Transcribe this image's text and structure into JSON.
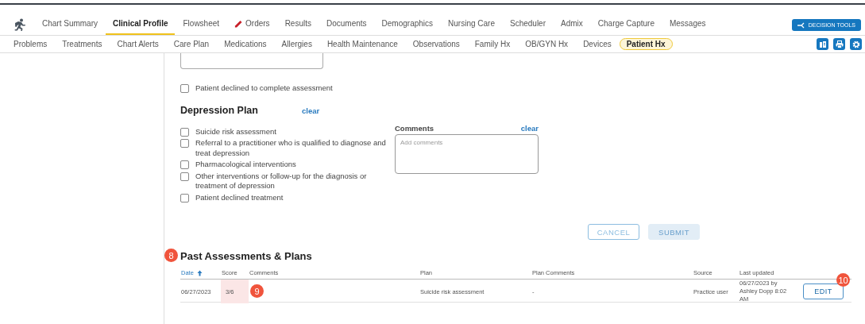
{
  "main_nav": [
    {
      "label": "Chart Summary",
      "selected": false,
      "kind": "text"
    },
    {
      "label": "Clinical Profile",
      "selected": true,
      "kind": "text"
    },
    {
      "label": "Flowsheet",
      "selected": false,
      "kind": "text"
    },
    {
      "label": "Orders",
      "selected": false,
      "kind": "pencil"
    },
    {
      "label": "Results",
      "selected": false,
      "kind": "text"
    },
    {
      "label": "Documents",
      "selected": false,
      "kind": "text"
    },
    {
      "label": "Demographics",
      "selected": false,
      "kind": "text"
    },
    {
      "label": "Nursing Care",
      "selected": false,
      "kind": "text"
    },
    {
      "label": "Scheduler",
      "selected": false,
      "kind": "text"
    },
    {
      "label": "Admix",
      "selected": false,
      "kind": "text"
    },
    {
      "label": "Charge Capture",
      "selected": false,
      "kind": "text"
    },
    {
      "label": "Messages",
      "selected": false,
      "kind": "text"
    }
  ],
  "decision_tools": "DECISION TOOLS",
  "sub_nav": [
    {
      "label": "Problems",
      "selected": false
    },
    {
      "label": "Treatments",
      "selected": false
    },
    {
      "label": "Chart Alerts",
      "selected": false
    },
    {
      "label": "Care Plan",
      "selected": false
    },
    {
      "label": "Medications",
      "selected": false
    },
    {
      "label": "Allergies",
      "selected": false
    },
    {
      "label": "Health Maintenance",
      "selected": false
    },
    {
      "label": "Observations",
      "selected": false
    },
    {
      "label": "Family Hx",
      "selected": false
    },
    {
      "label": "OB/GYN Hx",
      "selected": false
    },
    {
      "label": "Devices",
      "selected": false
    },
    {
      "label": "Patient Hx",
      "selected": true
    }
  ],
  "declined_assessment": {
    "label": "Patient declined to complete assessment",
    "checked": false
  },
  "depression_plan": {
    "title": "Depression Plan",
    "clear": "clear",
    "options": [
      {
        "label": "Suicide risk assessment",
        "checked": false
      },
      {
        "label": "Referral to a practitioner who is qualified to diagnose and treat depression",
        "checked": false
      },
      {
        "label": "Pharmacological interventions",
        "checked": false
      },
      {
        "label": "Other interventions or follow-up for the diagnosis or treatment of depression",
        "checked": false
      },
      {
        "label": "Patient declined treatment",
        "checked": false
      }
    ],
    "comments": {
      "label": "Comments",
      "clear": "clear",
      "placeholder": "Add comments"
    },
    "buttons": [
      {
        "label": "CANCEL",
        "kind": "outline",
        "disabled": true
      },
      {
        "label": "SUBMIT",
        "kind": "filled",
        "disabled": true
      }
    ]
  },
  "past": {
    "title": "Past Assessments & Plans",
    "title_callout": "8",
    "columns": [
      {
        "label": "Date",
        "sorted": true
      },
      {
        "label": "Score",
        "sorted": false
      },
      {
        "label": "Comments",
        "sorted": false
      },
      {
        "label": "Plan",
        "sorted": false
      },
      {
        "label": "Plan Comments",
        "sorted": false
      },
      {
        "label": "Source",
        "sorted": false
      },
      {
        "label": "Last updated",
        "sorted": false
      }
    ],
    "rows": [
      {
        "date": "06/27/2023",
        "score": "3/6",
        "score_flagged": true,
        "comments": "",
        "plan": "Suicide risk assessment",
        "plan_comments": "-",
        "source": "Practice user",
        "last_updated": "06/27/2023 by Ashley Dopp 8:02 AM",
        "action": "EDIT",
        "comments_callout": "9",
        "action_callout": "10"
      }
    ]
  }
}
